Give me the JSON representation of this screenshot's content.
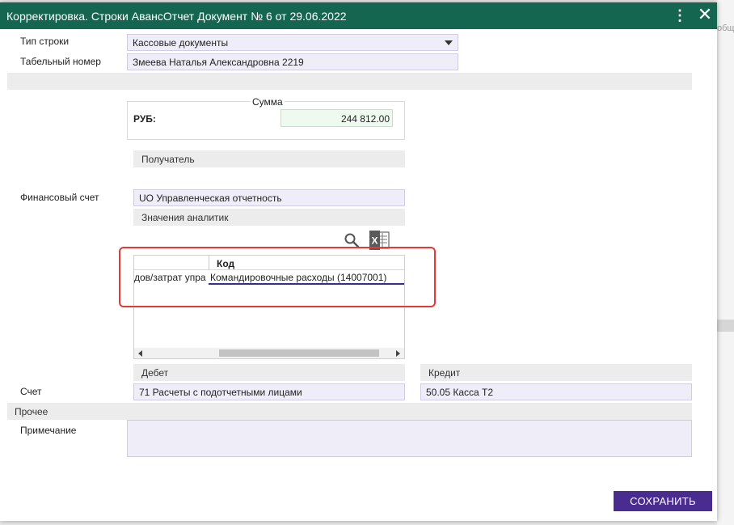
{
  "dialog": {
    "title": "Корректировка. Строки АвансОтчет Документ № 6 от 29.06.2022",
    "menu_icon": "kebab-menu-icon",
    "close_icon": "close-icon"
  },
  "background": {
    "fragment": "общ"
  },
  "form": {
    "row_type_label": "Тип строки",
    "row_type_value": "Кассовые документы",
    "tab_number_label": "Табельный номер",
    "tab_number_value": "Змеева Наталья Александровна 2219",
    "sum_legend": "Сумма",
    "currency_label": "РУБ:",
    "sum_value": "244 812.00",
    "recipient_bar": "Получатель",
    "fin_account_label": "Финансовый счет",
    "fin_account_value": "UO Управленческая отчетность",
    "analytics_bar": "Значения аналитик",
    "debit_bar": "Дебет",
    "credit_bar": "Кредит",
    "account_label": "Счет",
    "debit_value": "71 Расчеты с подотчетными лицами",
    "credit_value": "50.05 Касса Т2",
    "other_bar": "Прочее",
    "note_label": "Примечание",
    "note_value": ""
  },
  "grid": {
    "columns": [
      "",
      "Код"
    ],
    "rows": [
      [
        "дов/затрат упра",
        "Командировочные расходы (14007001)"
      ]
    ]
  },
  "icons": {
    "search": "search-icon",
    "excel": "excel-export-icon"
  },
  "actions": {
    "save_label": "СОХРАНИТЬ"
  },
  "colors": {
    "titlebar": "#146651",
    "save_button": "#4a2b8f",
    "highlight": "#e53935",
    "field_bg": "#efedf8"
  }
}
